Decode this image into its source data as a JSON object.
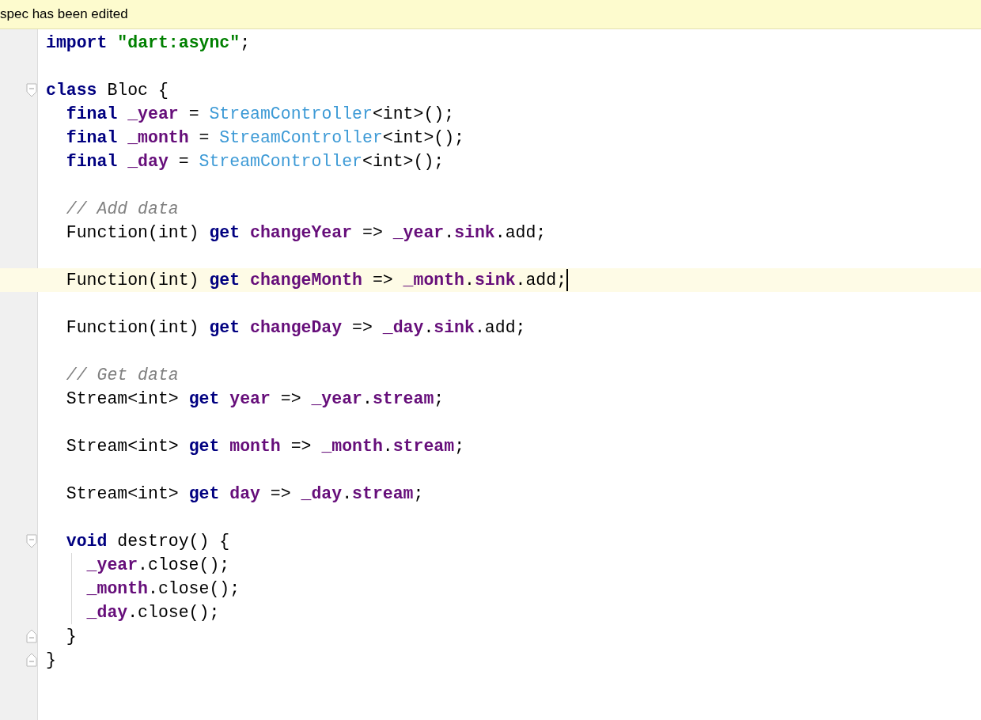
{
  "banner": {
    "text": "spec has been edited"
  },
  "lines": [
    {
      "current": false,
      "tokens": [
        {
          "kind": "keyword",
          "text": "import"
        },
        {
          "kind": "string",
          "text": " \"dart:async\""
        },
        {
          "kind": "plain",
          "text": ";"
        }
      ]
    },
    {
      "current": false
    },
    {
      "current": false,
      "tokens": [
        {
          "kind": "keyword",
          "text": "class"
        },
        {
          "kind": "plain",
          "text": " Bloc {"
        }
      ],
      "children": [
        {
          "current": false,
          "tokens": [
            {
              "kind": "keyword",
              "text": "final"
            },
            {
              "kind": "field",
              "text": " _year"
            },
            {
              "kind": "plain",
              "text": " = "
            },
            {
              "kind": "class",
              "text": "StreamController"
            },
            {
              "kind": "plain",
              "text": "<int>();"
            }
          ]
        },
        {
          "current": false,
          "tokens": [
            {
              "kind": "keyword",
              "text": "final"
            },
            {
              "kind": "field",
              "text": " _month"
            },
            {
              "kind": "plain",
              "text": " = "
            },
            {
              "kind": "class",
              "text": "StreamController"
            },
            {
              "kind": "plain",
              "text": "<int>();"
            }
          ]
        },
        {
          "current": false,
          "tokens": [
            {
              "kind": "keyword",
              "text": "final"
            },
            {
              "kind": "field",
              "text": " _day"
            },
            {
              "kind": "plain",
              "text": " = "
            },
            {
              "kind": "class",
              "text": "StreamController"
            },
            {
              "kind": "plain",
              "text": "<int>();"
            }
          ]
        },
        {
          "current": false
        },
        {
          "current": false,
          "tokens": [
            {
              "kind": "comment",
              "text": "// Add data"
            }
          ]
        },
        {
          "current": false,
          "tokens": [
            {
              "kind": "plain",
              "text": "Function(int) "
            },
            {
              "kind": "keyword",
              "text": "get"
            },
            {
              "kind": "field",
              "text": " changeYear"
            },
            {
              "kind": "plain",
              "text": " => "
            },
            {
              "kind": "field",
              "text": "_year"
            },
            {
              "kind": "plain",
              "text": "."
            },
            {
              "kind": "field",
              "text": "sink"
            },
            {
              "kind": "plain",
              "text": ".add;"
            }
          ]
        },
        {
          "current": false
        },
        {
          "current": true,
          "caret": true,
          "tokens": [
            {
              "kind": "plain",
              "text": "Function(int) "
            },
            {
              "kind": "keyword",
              "text": "get"
            },
            {
              "kind": "field",
              "text": " changeMonth"
            },
            {
              "kind": "plain",
              "text": " => "
            },
            {
              "kind": "field",
              "text": "_month"
            },
            {
              "kind": "plain",
              "text": "."
            },
            {
              "kind": "field",
              "text": "sink"
            },
            {
              "kind": "plain",
              "text": ".add;"
            }
          ]
        },
        {
          "current": false
        },
        {
          "current": false,
          "tokens": [
            {
              "kind": "plain",
              "text": "Function(int) "
            },
            {
              "kind": "keyword",
              "text": "get"
            },
            {
              "kind": "field",
              "text": " changeDay"
            },
            {
              "kind": "plain",
              "text": " => "
            },
            {
              "kind": "field",
              "text": "_day"
            },
            {
              "kind": "plain",
              "text": "."
            },
            {
              "kind": "field",
              "text": "sink"
            },
            {
              "kind": "plain",
              "text": ".add;"
            }
          ]
        },
        {
          "current": false
        },
        {
          "current": false,
          "tokens": [
            {
              "kind": "comment",
              "text": "// Get data"
            }
          ]
        },
        {
          "current": false,
          "tokens": [
            {
              "kind": "plain",
              "text": "Stream<int> "
            },
            {
              "kind": "keyword",
              "text": "get"
            },
            {
              "kind": "field",
              "text": " year"
            },
            {
              "kind": "plain",
              "text": " => "
            },
            {
              "kind": "field",
              "text": "_year"
            },
            {
              "kind": "plain",
              "text": "."
            },
            {
              "kind": "field",
              "text": "stream"
            },
            {
              "kind": "plain",
              "text": ";"
            }
          ]
        },
        {
          "current": false
        },
        {
          "current": false,
          "tokens": [
            {
              "kind": "plain",
              "text": "Stream<int> "
            },
            {
              "kind": "keyword",
              "text": "get"
            },
            {
              "kind": "field",
              "text": " month"
            },
            {
              "kind": "plain",
              "text": " => "
            },
            {
              "kind": "field",
              "text": "_month"
            },
            {
              "kind": "plain",
              "text": "."
            },
            {
              "kind": "field",
              "text": "stream"
            },
            {
              "kind": "plain",
              "text": ";"
            }
          ]
        },
        {
          "current": false
        },
        {
          "current": false,
          "tokens": [
            {
              "kind": "plain",
              "text": "Stream<int> "
            },
            {
              "kind": "keyword",
              "text": "get"
            },
            {
              "kind": "field",
              "text": " day"
            },
            {
              "kind": "plain",
              "text": " => "
            },
            {
              "kind": "field",
              "text": "_day"
            },
            {
              "kind": "plain",
              "text": "."
            },
            {
              "kind": "field",
              "text": "stream"
            },
            {
              "kind": "plain",
              "text": ";"
            }
          ]
        },
        {
          "current": false
        },
        {
          "current": false,
          "tokens": [
            {
              "kind": "keyword",
              "text": "void"
            },
            {
              "kind": "plain",
              "text": " destroy() {"
            }
          ],
          "children": [
            {
              "current": false,
              "tokens": [
                {
                  "kind": "field",
                  "text": "_year"
                },
                {
                  "kind": "plain",
                  "text": ".close();"
                }
              ]
            },
            {
              "current": false,
              "tokens": [
                {
                  "kind": "field",
                  "text": "_month"
                },
                {
                  "kind": "plain",
                  "text": ".close();"
                }
              ]
            },
            {
              "current": false,
              "tokens": [
                {
                  "kind": "field",
                  "text": "_day"
                },
                {
                  "kind": "plain",
                  "text": ".close();"
                }
              ]
            }
          ],
          "closing": {
            "current": false,
            "tokens": [
              {
                "kind": "plain",
                "text": "}"
              }
            ]
          }
        }
      ],
      "closing": {
        "current": false,
        "tokens": [
          {
            "kind": "plain",
            "text": "}"
          }
        ]
      }
    }
  ]
}
